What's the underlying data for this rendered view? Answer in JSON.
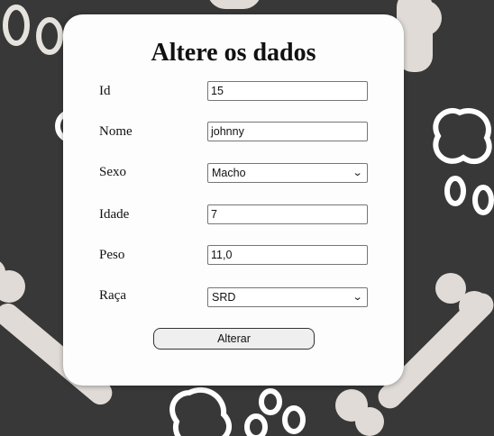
{
  "form": {
    "title": "Altere os dados",
    "fields": [
      {
        "label": "Id",
        "value": "15",
        "type": "input"
      },
      {
        "label": "Nome",
        "value": "johnny",
        "type": "input"
      },
      {
        "label": "Sexo",
        "value": "Macho",
        "type": "select"
      },
      {
        "label": "Idade",
        "value": "7",
        "type": "input"
      },
      {
        "label": "Peso",
        "value": "11,0",
        "type": "input"
      },
      {
        "label": "Raça",
        "value": "SRD",
        "type": "select"
      }
    ],
    "submit_label": "Alterar"
  },
  "colors": {
    "background": "#383838",
    "pattern": "#e0dbd6",
    "card": "#fdfdfd"
  }
}
